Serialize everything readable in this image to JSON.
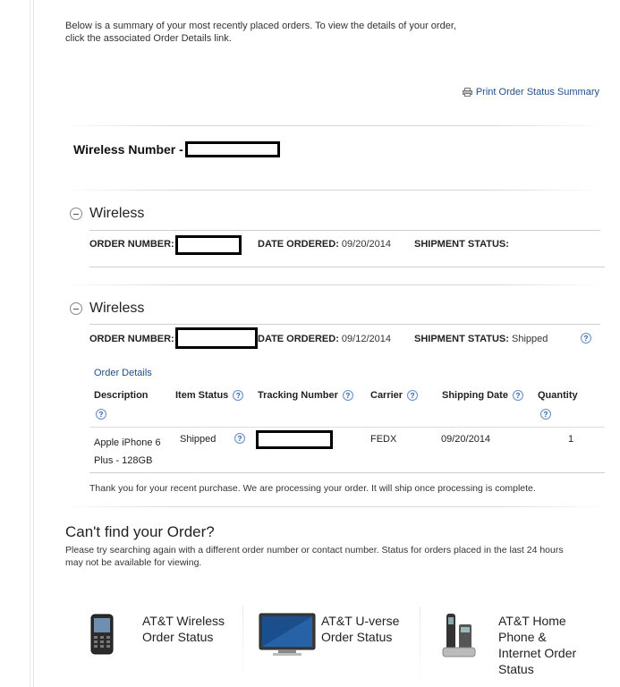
{
  "intro": {
    "line1": "Below is a summary of your most recently placed orders. To view the details of your order,",
    "line2": "click the associated Order Details link."
  },
  "print_link": "Print Order Status Summary",
  "wireless_number_label": "Wireless Number -",
  "orders": [
    {
      "title": "Wireless",
      "order_number_label": "ORDER NUMBER:",
      "date_label": "DATE ORDERED:",
      "date_value": "09/20/2014",
      "status_label": "SHIPMENT STATUS:",
      "status_value": ""
    },
    {
      "title": "Wireless",
      "order_number_label": "ORDER NUMBER:",
      "date_label": "DATE ORDERED:",
      "date_value": "09/12/2014",
      "status_label": "SHIPMENT STATUS:",
      "status_value": "Shipped"
    }
  ],
  "order_details_link": "Order Details",
  "table": {
    "headers": [
      "Description",
      "Item Status",
      "Tracking Number",
      "Carrier",
      "Shipping Date",
      "Quantity"
    ],
    "row": {
      "description_line1": "Apple iPhone 6",
      "description_line2": "Plus - 128GB",
      "item_status": "Shipped",
      "carrier": "FEDX",
      "shipping_date": "09/20/2014",
      "quantity": "1"
    }
  },
  "thanks": "Thank you for your recent purchase. We are processing your order. It will ship once processing is complete.",
  "cant_find": {
    "title": "Can't find your Order?",
    "text_line1": "Please try searching again with a different order number or contact number. Status for orders placed in the last 24 hours",
    "text_line2": "may not be available for viewing."
  },
  "tiles": [
    {
      "label": "AT&T Wireless Order Status",
      "icon": "mobile-phone-icon"
    },
    {
      "label": "AT&T U-verse Order Status",
      "icon": "monitor-icon"
    },
    {
      "label": "AT&T Home Phone & Internet Order Status",
      "icon": "home-phone-icon"
    }
  ],
  "colors": {
    "link": "#1f4e8c",
    "help": "#2a5aa0"
  }
}
